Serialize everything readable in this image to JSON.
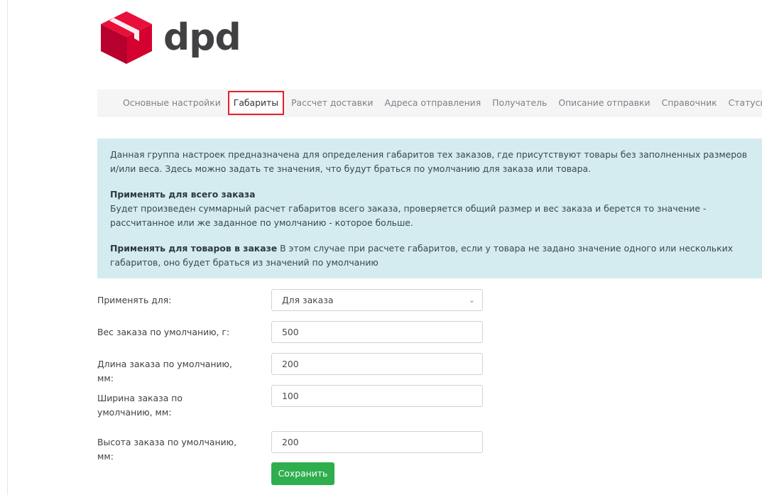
{
  "logo": {
    "text": "dpd",
    "brand_color": "#dc0032"
  },
  "tabs": [
    {
      "label": "Основные настройки"
    },
    {
      "label": "Габариты",
      "active": true
    },
    {
      "label": "Рассчет доставки"
    },
    {
      "label": "Адреса отправления"
    },
    {
      "label": "Получатель"
    },
    {
      "label": "Описание отправки"
    },
    {
      "label": "Справочник"
    },
    {
      "label": "Статусы"
    }
  ],
  "info": {
    "intro": "Данная группа настроек предназначена для определения габаритов тех заказов, где присутствуют товары без заполненных размеров и/или веса. Здесь можно задать те значения, что будут браться по умолчанию для заказа или товара.",
    "order_title": "Применять для всего заказа",
    "order_text": "Будет произведен суммарный расчет габаритов всего заказа, проверяется общий размер и вес заказа и берется то значение - рассчитанное или же заданное по умолчанию - которое больше.",
    "goods_title": "Применять для товаров в заказе",
    "goods_text": " В этом случае при расчете габаритов, если у товара не задано значение одного или нескольких габаритов, оно будет браться из значений по умолчанию"
  },
  "form": {
    "apply_label": "Применять для:",
    "apply_value": "Для заказа",
    "weight_label": "Вес заказа по умолчанию, г:",
    "weight_value": "500",
    "length_label": "Длина заказа по умолчанию, мм:",
    "length_value": "200",
    "width_label": "Ширина заказа по умолчанию, мм:",
    "width_value": "100",
    "height_label": "Высота заказа по умолчанию, мм:",
    "height_value": "200",
    "save_label": "Сохранить"
  },
  "colors": {
    "accent_green": "#2fae4e",
    "info_bg": "#d4ecef",
    "active_tab_border": "#e2202a"
  }
}
